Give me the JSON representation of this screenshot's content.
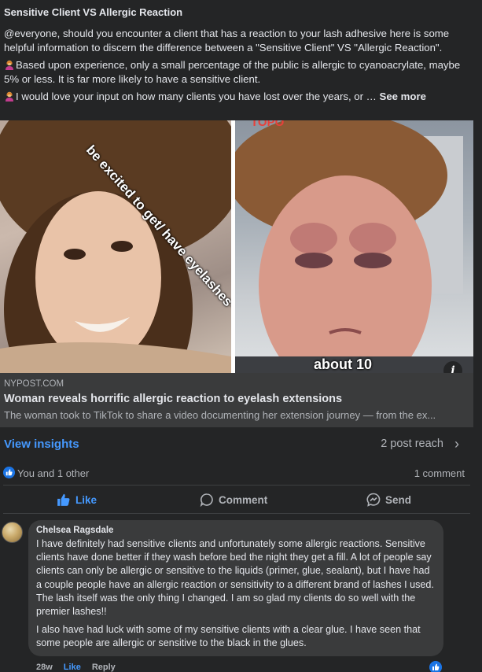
{
  "post": {
    "title": "Sensitive Client VS Allergic Reaction",
    "paragraph_1": "@everyone, should you encounter a client that has a reaction to your lash adhesive here is some helpful information to discern the difference between a \"Sensitive Client\" VS \"Allergic Reaction\".",
    "paragraph_2": "Based upon experience, only a small percentage of the public is allergic to cyanoacrylate, maybe 5% or less. It is far more likely to have a sensitive client.",
    "paragraph_3": "I would love your input on how many clients you have lost over the years, or …",
    "see_more": "See more"
  },
  "link_preview": {
    "overlay_left": "be excited to get/ have eyelashes*",
    "overlay_right_top": "TOPO",
    "overlay_right_bottom": "about 10",
    "info_icon": "i",
    "domain": "NYPOST.COM",
    "title": "Woman reveals horrific allergic reaction to eyelash extensions",
    "description": "The woman took to TikTok to share a video documenting her extension journey — from the ex..."
  },
  "insights": {
    "label": "View insights",
    "reach": "2 post reach",
    "chevron": "›"
  },
  "reactions": {
    "text": "You and 1 other",
    "comment_count": "1 comment"
  },
  "actions": {
    "like": "Like",
    "comment": "Comment",
    "send": "Send"
  },
  "comment": {
    "author": "Chelsea Ragsdale",
    "paragraph_1": "I have definitely had sensitive clients and unfortunately some allergic reactions. Sensitive clients have done better if they wash before bed the night they get a fill. A lot of people say clients can only be allergic or sensitive to the liquids (primer, glue, sealant), but I have had a couple people have an allergic reaction or sensitivity to a different brand of lashes I used. The lash itself was the only thing I changed. I am so glad my clients do so well with the premier lashes!!",
    "paragraph_2": "I also have had luck with some of my sensitive clients with a clear glue. I have seen that some people are allergic or sensitive to the black in the glues.",
    "time": "28w",
    "like": "Like",
    "reply": "Reply"
  },
  "colors": {
    "background": "#242526",
    "link_blue": "#4599ff",
    "reaction_blue": "#1b74e4",
    "secondary_text": "#b0b3b8"
  },
  "icons": [
    "person-tipping-hand-emoji",
    "info-icon",
    "chevron-right-icon",
    "like-badge-icon",
    "thumbs-up-icon",
    "comment-icon",
    "messenger-icon",
    "avatar"
  ]
}
